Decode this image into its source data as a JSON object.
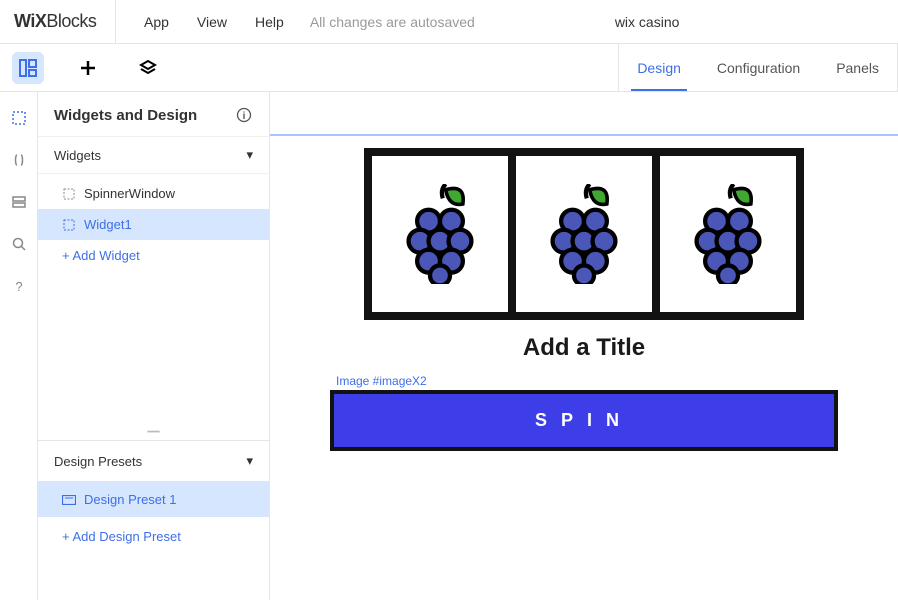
{
  "logo": {
    "wix": "WiX",
    "blocks": "Blocks"
  },
  "menu": {
    "app": "App",
    "view": "View",
    "help": "Help",
    "autosave": "All changes are autosaved",
    "project": "wix casino"
  },
  "tabs": {
    "design": "Design",
    "configuration": "Configuration",
    "panels": "Panels"
  },
  "sidebar": {
    "title": "Widgets and Design",
    "widgets_head": "Widgets",
    "items": [
      {
        "label": "SpinnerWindow"
      },
      {
        "label": "Widget1"
      }
    ],
    "add_widget": "+ Add Widget",
    "presets_head": "Design Presets",
    "preset1": "Design Preset 1",
    "add_preset": "+ Add Design Preset"
  },
  "canvas": {
    "title": "Add a Title",
    "image_label": "Image #imageX2",
    "spin": "SPIN"
  }
}
